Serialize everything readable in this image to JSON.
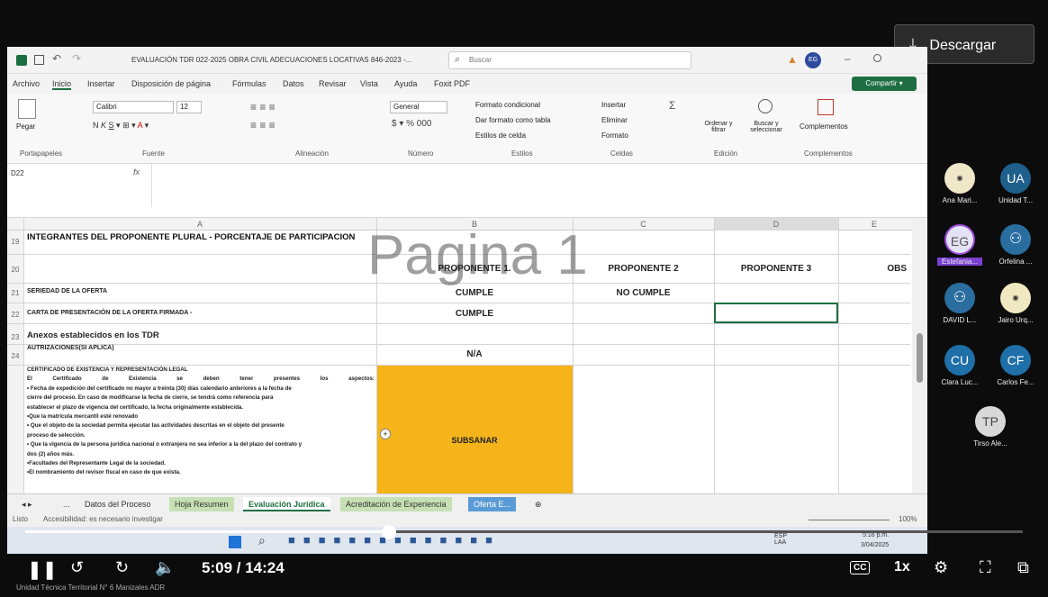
{
  "download_button": {
    "label": "Descargar",
    "icon": "download-icon"
  },
  "excel": {
    "title": "EVALUACIÓN TDR 022-2025 OBRA CIVIL ADECUACIONES LOCATIVAS 846-2023 -...",
    "search_placeholder": "Buscar",
    "user_initials": "EG",
    "menu": [
      "Archivo",
      "Inicio",
      "Insertar",
      "Disposición de página",
      "Fórmulas",
      "Datos",
      "Revisar",
      "Vista",
      "Ayuda",
      "Foxit PDF"
    ],
    "share_label": "Compartir",
    "ribbon": {
      "paste": "Pegar",
      "font_name": "Calibri",
      "font_size": "12",
      "number_format": "General",
      "cond_format": "Formato condicional",
      "table_format": "Dar formato como tabla",
      "cell_styles": "Estilos de celda",
      "insert": "Insertar",
      "delete": "Eliminar",
      "format": "Formato",
      "sort_filter": "Ordenar y filtrar",
      "find_select": "Buscar y seleccionar",
      "complements": "Complementos",
      "groups": [
        "Portapapeles",
        "Fuente",
        "Alineación",
        "Número",
        "Estilos",
        "Celdas",
        "Edición",
        "Complementos"
      ]
    },
    "name_box": "D22",
    "fx": "fx",
    "columns": [
      "A",
      "B",
      "C",
      "D",
      "E"
    ],
    "rows": [
      {
        "num": "19",
        "a": "INTEGRANTES DEL PROPONENTE PLURAL - PORCENTAJE DE PARTICIPACION",
        "b": "",
        "c": ""
      },
      {
        "num": "20",
        "a": "",
        "b": "PROPONENTE 1.",
        "c": "PROPONENTE 2",
        "d": "PROPONENTE 3",
        "e": "OBS"
      },
      {
        "num": "21",
        "a": "SERIEDAD DE LA OFERTA",
        "b": "CUMPLE",
        "c": "NO CUMPLE"
      },
      {
        "num": "22",
        "a": "CARTA DE PRESENTACIÓN DE LA OFERTA FIRMADA -",
        "b": "CUMPLE",
        "c": ""
      },
      {
        "num": "23",
        "a": "Anexos establecidos en los TDR",
        "b": "",
        "c": ""
      },
      {
        "num": "24",
        "a": "AUTRIZACIONES(SI APLICA)",
        "b": "N/A",
        "c": ""
      }
    ],
    "big_cell": {
      "title": "CERTIFICADO DE EXISTENCIA Y REPRESENTACIÓN LEGAL",
      "lines": [
        "El Certificado de Existencia se deben tener presentes los aspectos:",
        "• Fecha de expedición del certificado no mayor a treinta (30) días calendario anteriores a la fecha de",
        "cierre del proceso. En caso de modificarse la fecha de cierre, se tendrá como referencia para",
        "establecer el plazo de vigencia del certificado, la fecha originalmente establecida.",
        "•Que la matrícula mercantil esté renovado",
        "• Que el objeto de la sociedad permita ejecutar las actividades descritas en el objeto del presente",
        "proceso de selección.",
        "• Que la vigencia de la persona jurídica nacional o extranjera no sea inferior a la del plazo del contrato y",
        "dos (2) años más.",
        "•Facultades del Representante Legal de la sociedad.",
        "•El nombramiento del revisor fiscal en caso de que exista."
      ],
      "status": "SUBSANAR"
    },
    "watermark": "Pagina 1",
    "tabs": [
      "...",
      "Datos del Proceso",
      "Hoja Resumen",
      "Evaluación Jurídica",
      "Acreditación de Experiencia",
      "Oferta E..."
    ],
    "active_tab": "Evaluación Jurídica",
    "status": {
      "left": "Listo",
      "accessibility": "Accesibilidad: es necesario investigar",
      "zoom": "100%"
    }
  },
  "taskbar": {
    "lang": "ESP\nLAA",
    "time": "5:16 p.m.",
    "date": "3/04/2025"
  },
  "participants": [
    {
      "initials": "",
      "name": "Ana Mari...",
      "color": "#e8e0c8"
    },
    {
      "initials": "UA",
      "name": "Unidad T...",
      "color": "#1f5f8b"
    },
    {
      "initials": "EG",
      "name": "Estefania...",
      "color": "#e3e3f5"
    },
    {
      "initials": "",
      "name": "Orfelina ...",
      "color": "#2a6ea0"
    },
    {
      "initials": "",
      "name": "DAVID L...",
      "color": "#2a6ea0"
    },
    {
      "initials": "",
      "name": "Jairo Urq...",
      "color": "#f0e8c0"
    },
    {
      "initials": "CU",
      "name": "Clara Luc...",
      "color": "#1f6fa8"
    },
    {
      "initials": "CF",
      "name": "Carlos Fe...",
      "color": "#1f6fa8"
    },
    {
      "initials": "TP",
      "name": "Tirso Ale...",
      "color": "#d8d8d8"
    }
  ],
  "player": {
    "time": "5:09 / 14:24",
    "speed": "1x",
    "progress": 0.365,
    "caption_label": "CC",
    "footer": "Unidad Técnica Territorial N° 6 Manizales ADR"
  }
}
